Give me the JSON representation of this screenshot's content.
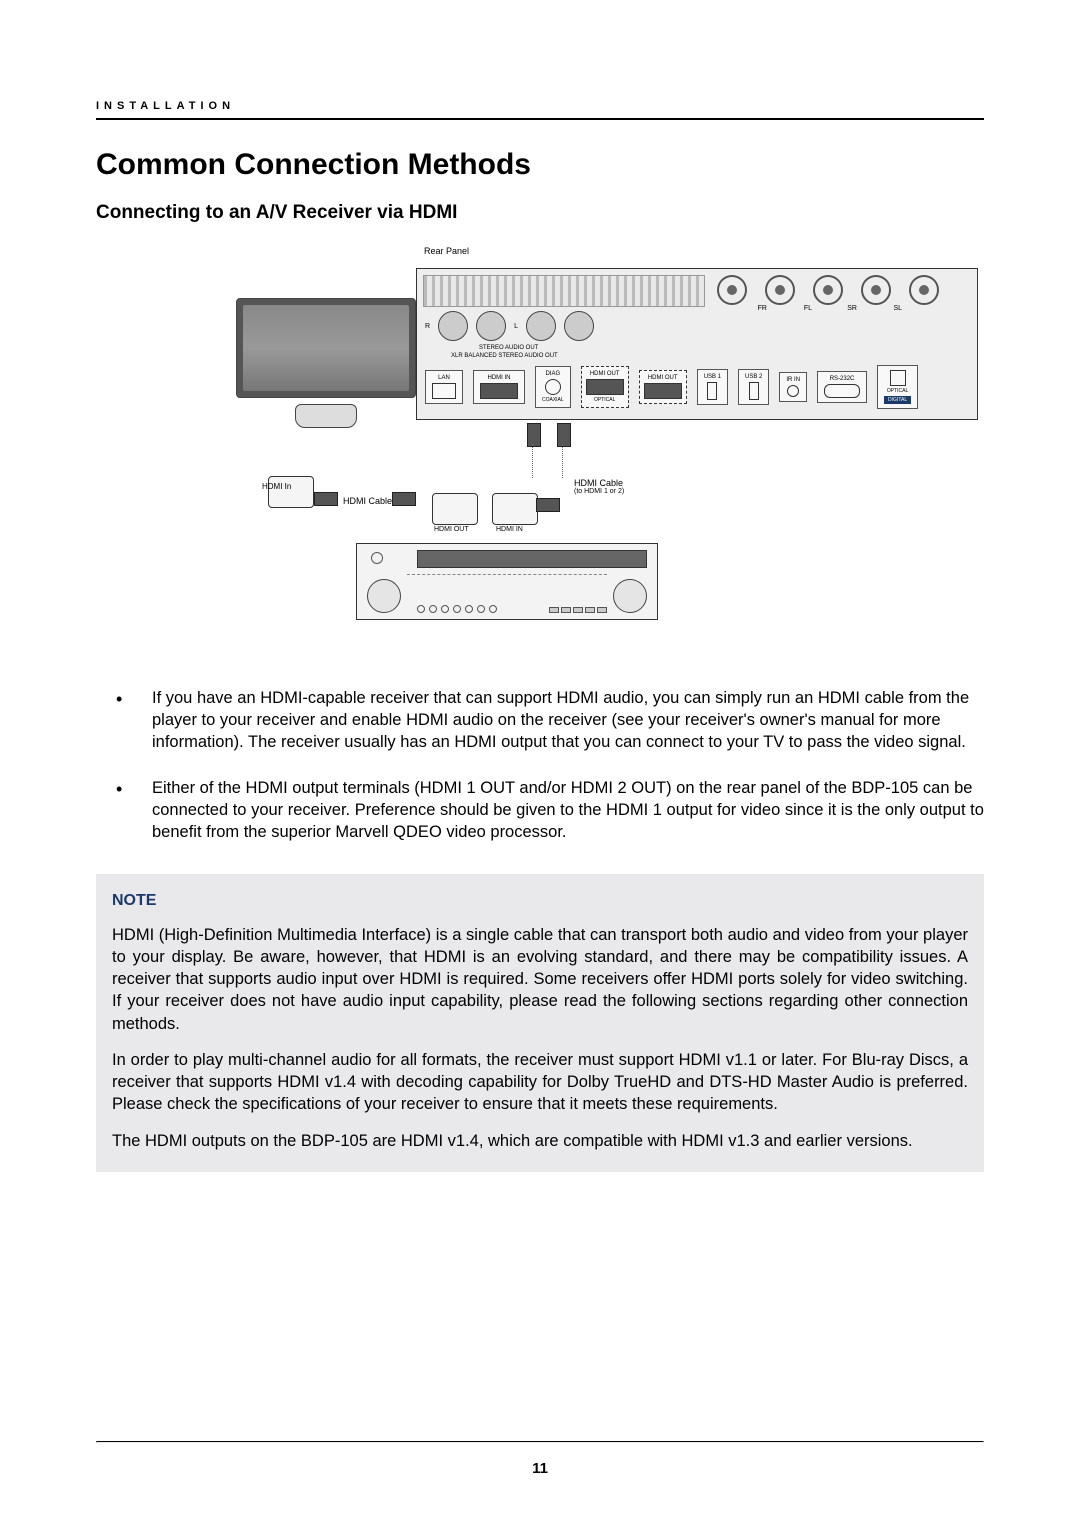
{
  "running_head": "INSTALLATION",
  "h1": "Common Connection Methods",
  "h2": "Connecting to an A/V Receiver via HDMI",
  "diagram": {
    "rear_panel_label": "Rear Panel",
    "vent_label": "",
    "stereo_audio_out": "STEREO AUDIO OUT",
    "xlr_balanced": "XLR BALANCED STEREO AUDIO OUT",
    "rca_labels": [
      "FR",
      "FL",
      "SR",
      "SL"
    ],
    "port_labels": {
      "lan": "LAN",
      "hdmi_in": "HDMI IN",
      "diag": "DIAG",
      "hdmi_out1": "HDMI OUT",
      "hdmi_out2": "HDMI OUT",
      "usb1": "USB 1",
      "usb2": "USB 2",
      "ir_in": "IR IN",
      "rs232": "RS-232C",
      "optical": "OPTICAL",
      "coaxial": "COAXIAL",
      "digital": "DIGITAL"
    },
    "hdmi_in_tv": "HDMI In",
    "hdmi_cable_tv": "HDMI Cable",
    "hdmi_cable_right": "HDMI Cable",
    "hdmi_cable_right_sub": "(to HDMI 1 or 2)",
    "hdmi_out_receiver": "HDMI OUT",
    "hdmi_in_receiver": "HDMI IN"
  },
  "bullets": [
    "If you have an HDMI-capable receiver that can support HDMI audio, you can simply run an HDMI cable from the player to your receiver and enable HDMI audio on the receiver (see your receiver's owner's manual for more information). The receiver usually has an HDMI output that you can connect to your TV to pass the video signal.",
    "Either of the HDMI output terminals (HDMI 1 OUT and/or HDMI 2 OUT) on the rear panel of the BDP-105 can be connected to your receiver. Preference should be given to the HDMI 1 output for video since it is the only output to benefit from the superior Marvell QDEO video processor."
  ],
  "note": {
    "title": "NOTE",
    "paragraphs": [
      "HDMI (High-Definition Multimedia Interface) is a single cable that can transport both audio and video from your player to your display. Be aware, however, that HDMI is an evolving standard, and there may be compatibility issues. A receiver that supports audio input over HDMI is required. Some receivers offer HDMI ports solely for video switching. If your receiver does not have audio input capability, please read the following sections regarding other connection methods.",
      "In order to play multi-channel audio for all formats, the receiver must support HDMI v1.1 or later. For Blu-ray Discs, a receiver that supports HDMI v1.4 with decoding capability for Dolby TrueHD and DTS-HD Master Audio is preferred. Please check the specifications of your receiver to ensure that it meets these requirements.",
      "The HDMI outputs on the BDP-105 are HDMI v1.4, which are compatible with HDMI v1.3 and earlier versions."
    ]
  },
  "page_number": "11"
}
